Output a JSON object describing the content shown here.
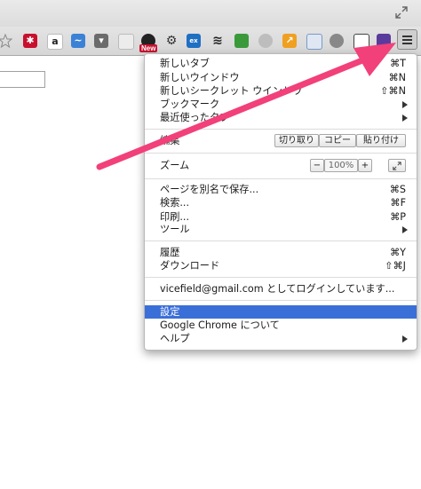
{
  "menu": {
    "items": [
      {
        "label": "新しいタブ",
        "shortcut": "⌘T"
      },
      {
        "label": "新しいウインドウ",
        "shortcut": "⌘N"
      },
      {
        "label": "新しいシークレット ウインドウ",
        "shortcut": "⇧⌘N"
      },
      {
        "label": "ブックマーク"
      },
      {
        "label": "最近使ったタブ"
      }
    ],
    "edit": {
      "label": "編集",
      "cut": "切り取り",
      "copy": "コピー",
      "paste": "貼り付け"
    },
    "zoom": {
      "label": "ズーム",
      "minus": "−",
      "level": "100%",
      "plus": "+"
    },
    "page_items": [
      {
        "label": "ページを別名で保存...",
        "shortcut": "⌘S"
      },
      {
        "label": "検索...",
        "shortcut": "⌘F"
      },
      {
        "label": "印刷...",
        "shortcut": "⌘P"
      },
      {
        "label": "ツール"
      }
    ],
    "history": {
      "label": "履歴",
      "shortcut": "⌘Y"
    },
    "downloads": {
      "label": "ダウンロード",
      "shortcut": "⇧⌘J"
    },
    "signin": "vicefield@gmail.com としてログインしています...",
    "settings": "設定",
    "about": "Google Chrome について",
    "help": "ヘルプ"
  },
  "toolbar": {
    "new_badge": "New"
  },
  "colors": {
    "selected": "#3b6fd8",
    "annotation_arrow": "#f2407a"
  }
}
